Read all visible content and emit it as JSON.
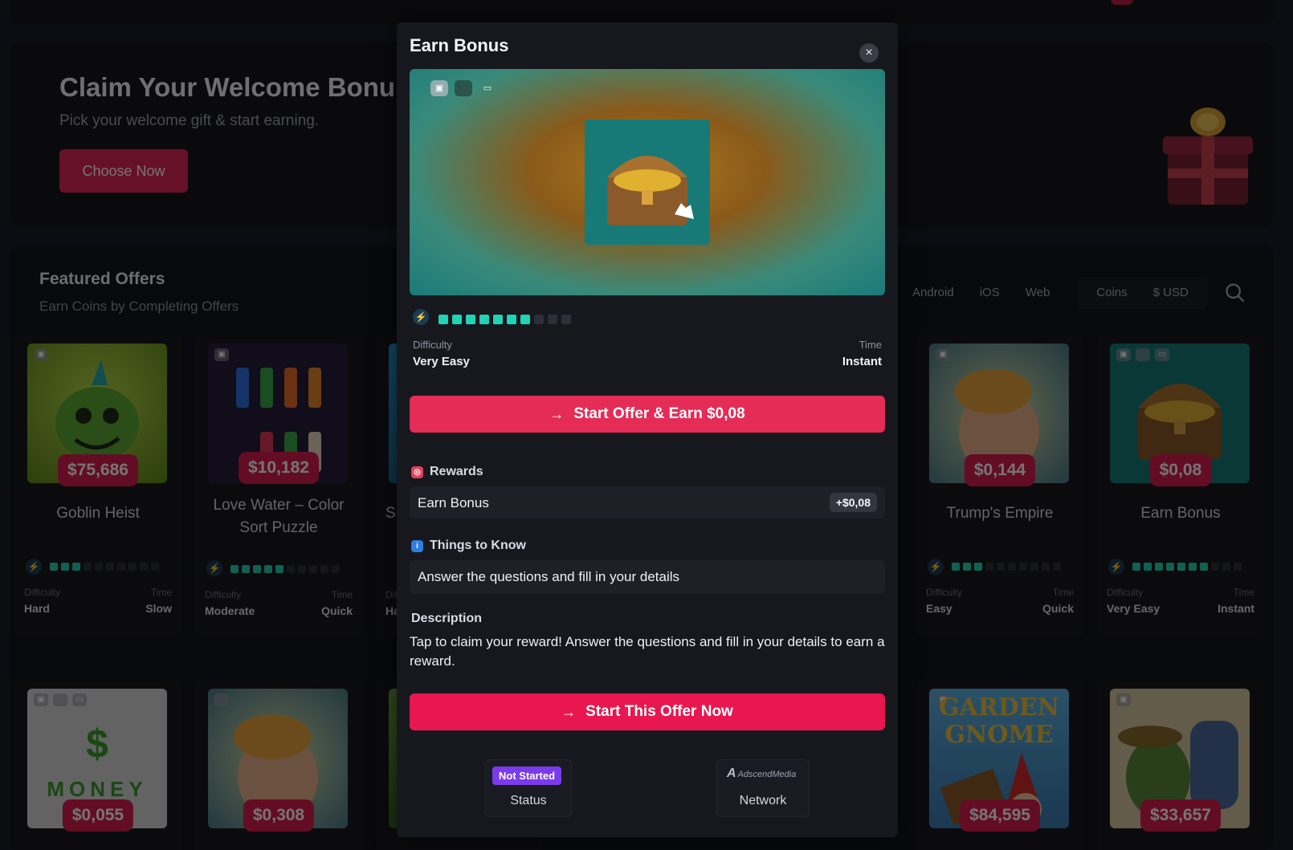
{
  "welcome": {
    "title": "Claim Your Welcome Bonus",
    "subtitle": "Pick your welcome gift & start earning.",
    "button": "Choose Now"
  },
  "featured": {
    "title": "Featured Offers",
    "subtitle": "Earn Coins by Completing Offers"
  },
  "filters": {
    "platforms": [
      "Android",
      "iOS",
      "Web"
    ],
    "currency": [
      "Coins",
      "$ USD"
    ]
  },
  "cards": [
    {
      "title": "Goblin Heist",
      "price": "$75,686",
      "difficulty_label": "Difficulty",
      "difficulty": "Hard",
      "time_label": "Time",
      "time": "Slow",
      "level": 3
    },
    {
      "title": "Love Water – Color Sort Puzzle",
      "price": "$10,182",
      "difficulty_label": "Difficulty",
      "difficulty": "Moderate",
      "time_label": "Time",
      "time": "Quick",
      "level": 5
    },
    {
      "title": "Trump's Empire",
      "price": "$0,144",
      "difficulty_label": "Difficulty",
      "difficulty": "Easy",
      "time_label": "Time",
      "time": "Quick",
      "level": 3
    },
    {
      "title": "Earn Bonus",
      "price": "$0,08",
      "difficulty_label": "Difficulty",
      "difficulty": "Very Easy",
      "time_label": "Time",
      "time": "Instant",
      "level": 7
    }
  ],
  "partial_card": {
    "title_fragment": "S",
    "difficulty_fragment": "Dif",
    "value_fragment": "Ha"
  },
  "bottom_cards": [
    {
      "price": "$0,055",
      "image_text": "MONEY"
    },
    {
      "price": "$0,308"
    },
    {
      "price": "$84,595",
      "image_text_1": "GARDEN",
      "image_text_2": "GNOME"
    },
    {
      "price": "$33,657"
    }
  ],
  "modal": {
    "title": "Earn Bonus",
    "close": "×",
    "level": 7,
    "level_max": 10,
    "difficulty_label": "Difficulty",
    "difficulty": "Very Easy",
    "time_label": "Time",
    "time": "Instant",
    "cta_primary": "Start Offer & Earn $0,08",
    "rewards_title": "Rewards",
    "reward_name": "Earn Bonus",
    "reward_amount": "+$0,08",
    "things_title": "Things to Know",
    "things_text": "Answer the questions and fill in your details",
    "description_title": "Description",
    "description": "Tap to claim your reward! Answer the questions and fill in your details to earn a reward.",
    "cta_secondary": "Start This Offer Now",
    "status_badge": "Not Started",
    "status_label": "Status",
    "network_logo": "AdscendMedia",
    "network_label": "Network"
  },
  "colors": {
    "accent": "#e42c56",
    "level_on": "#22d3b3",
    "badge": "#7c3aed"
  }
}
